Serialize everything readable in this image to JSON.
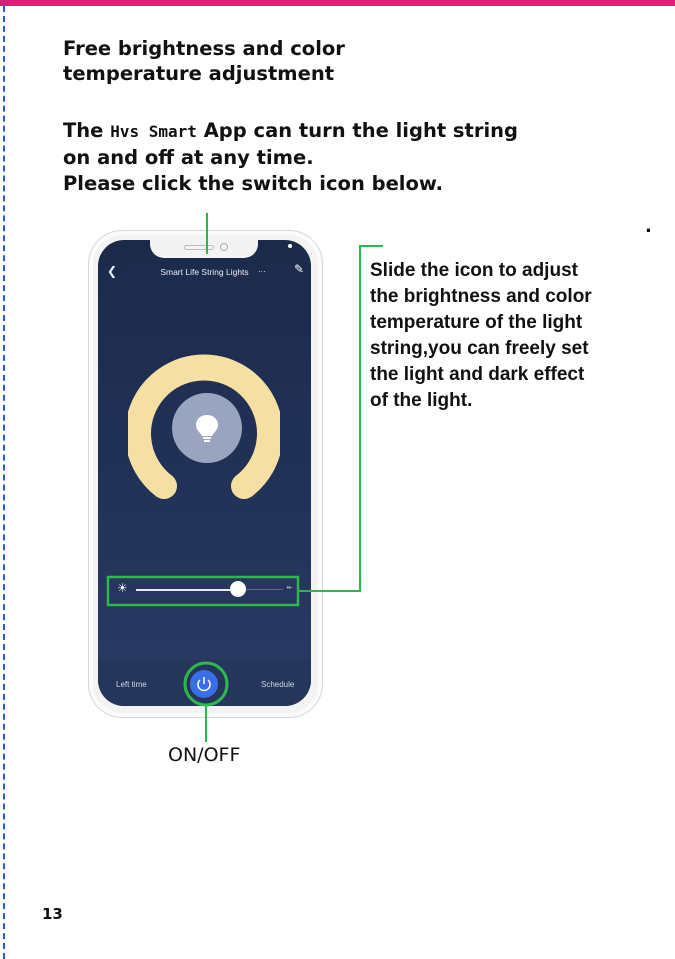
{
  "heading": [
    "Free brightness and color",
    "temperature adjustment"
  ],
  "intro": {
    "prefix": "The",
    "brand": "Hvs Smart",
    "line1_rest": "App can turn the light string",
    "line2": "on and off at any time.",
    "line3": "Please click the switch icon below."
  },
  "stray_mark": ".",
  "phone": {
    "app_title": "Smart Life String Lights",
    "more_text": "...",
    "left_tab": "Left time",
    "right_tab": "Schedule",
    "back_icon": "chevron-left-icon",
    "edit_icon": "pencil-icon",
    "power_icon": "power-icon",
    "brightness_icon": "sun-icon",
    "slider_level": 0.72,
    "ring_color": "#f5dfa3",
    "power_color": "#3a6ee8"
  },
  "callout_text": [
    "Slide the icon to adjust",
    "the brightness and color",
    "temperature of the light",
    "string,you can freely set",
    "the light and dark effect",
    "of the light."
  ],
  "onoff_label": "ON/OFF",
  "page_number": "13",
  "colors": {
    "accent_line": "#2eb84b",
    "top_rule": "#d81f7a",
    "margin_dash": "#2a5bd7"
  }
}
